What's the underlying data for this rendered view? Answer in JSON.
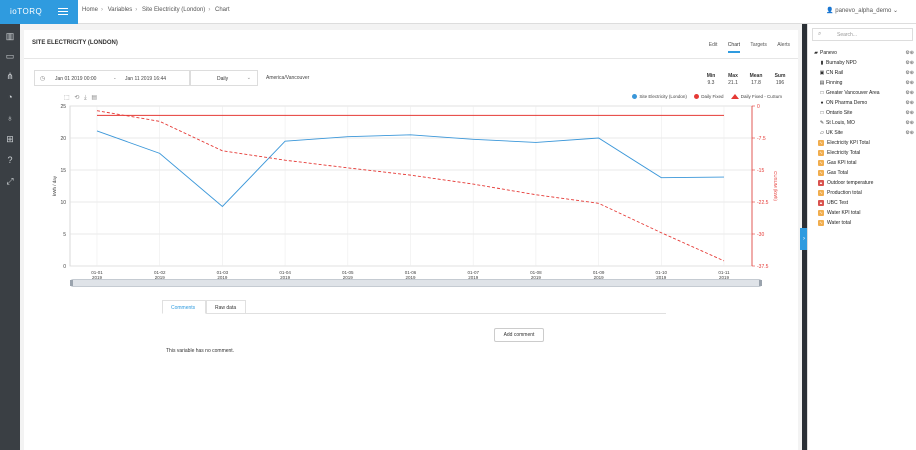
{
  "app": {
    "logo": "ioTORQ"
  },
  "breadcrumb": [
    "Home",
    "Variables",
    "Site Electricity (London)",
    "Chart"
  ],
  "user": {
    "name": "panevo_alpha_demo"
  },
  "page": {
    "title": "SITE ELECTRICITY (LONDON)",
    "tabs": [
      "Edit",
      "Chart",
      "Targets",
      "Alerts"
    ],
    "active_tab": "Chart"
  },
  "controls": {
    "date_from": "Jan 01 2019 00:00",
    "date_separator": "-",
    "date_to": "Jan 11 2019 16:44",
    "period": "Daily",
    "timezone": "America/Vancouver"
  },
  "stats": [
    {
      "label": "Min",
      "value": "9.3"
    },
    {
      "label": "Max",
      "value": "21.1"
    },
    {
      "label": "Mean",
      "value": "17.8"
    },
    {
      "label": "Sum",
      "value": "196"
    }
  ],
  "legend": [
    {
      "label": "Site Electricity (London)",
      "color": "#3b97d9",
      "shape": "dot"
    },
    {
      "label": "Daily Fixed",
      "color": "#e53935",
      "shape": "dot"
    },
    {
      "label": "Daily Fixed - CuSum",
      "color": "#e53935",
      "shape": "triangle"
    }
  ],
  "chart_data": {
    "type": "line",
    "x": [
      "01-01 2019",
      "01-02 2019",
      "01-03 2019",
      "01-04 2019",
      "01-05 2019",
      "01-06 2019",
      "01-07 2019",
      "01-08 2019",
      "01-09 2019",
      "01-10 2019",
      "01-11 2019"
    ],
    "series": [
      {
        "name": "Site Electricity (London)",
        "axis": "left",
        "style": "solid",
        "color": "#3b97d9",
        "values": [
          21.1,
          17.6,
          9.3,
          19.5,
          20.2,
          20.5,
          19.8,
          19.3,
          20.0,
          13.8,
          13.9
        ]
      },
      {
        "name": "Daily Fixed",
        "axis": "right",
        "style": "solid",
        "color": "#e53935",
        "values": [
          -2.2,
          -2.2,
          -2.2,
          -2.2,
          -2.2,
          -2.2,
          -2.2,
          -2.2,
          -2.2,
          -2.2,
          -2.2
        ]
      },
      {
        "name": "Daily Fixed - CuSum",
        "axis": "right",
        "style": "dashed",
        "color": "#e53935",
        "values": [
          -1.1,
          -3.6,
          -10.5,
          -12.7,
          -14.5,
          -16.2,
          -18.3,
          -20.8,
          -22.8,
          -29.7,
          -36.3
        ]
      }
    ],
    "ylabel_left": "kWh / day",
    "ylabel_right": "CUSUM (kWh)",
    "ylim_left": [
      0,
      25
    ],
    "yticks_left": [
      0,
      5,
      10,
      15,
      20,
      25
    ],
    "ylim_right": [
      -37.5,
      0
    ],
    "yticks_right": [
      "0",
      "-7.5",
      "-15",
      "-22.5",
      "-30",
      "-37.5"
    ],
    "grid": true
  },
  "comments": {
    "tabs": [
      "Comments",
      "Raw data"
    ],
    "add_label": "Add comment",
    "empty_text": "This variable has no comment."
  },
  "search": {
    "placeholder": "Search..."
  },
  "tree": [
    {
      "label": "Panevo",
      "icon": "folder",
      "tag": ""
    },
    {
      "label": "Burnaby NPD",
      "icon": "bar-chart",
      "tag": ""
    },
    {
      "label": "CN Rail",
      "icon": "train",
      "tag": ""
    },
    {
      "label": "Finning",
      "icon": "building",
      "tag": ""
    },
    {
      "label": "Greater Vancouver Area",
      "icon": "square",
      "tag": ""
    },
    {
      "label": "ON Pharma Demo",
      "icon": "person",
      "tag": ""
    },
    {
      "label": "Ontario Site",
      "icon": "square",
      "tag": ""
    },
    {
      "label": "St Louis, MO",
      "icon": "tool",
      "tag": ""
    },
    {
      "label": "UK Site",
      "icon": "folder-open",
      "tag": ""
    },
    {
      "label": "Electricity KPI Total",
      "icon": "",
      "tag": "y"
    },
    {
      "label": "Electricity Total",
      "icon": "",
      "tag": "y"
    },
    {
      "label": "Gas KPI total",
      "icon": "",
      "tag": "y"
    },
    {
      "label": "Gas Total",
      "icon": "",
      "tag": "y"
    },
    {
      "label": "Outdoor temperature",
      "icon": "",
      "tag": "r"
    },
    {
      "label": "Production total",
      "icon": "",
      "tag": "y"
    },
    {
      "label": "UBC Test",
      "icon": "",
      "tag": "r"
    },
    {
      "label": "Water KPI total",
      "icon": "",
      "tag": "y"
    },
    {
      "label": "Water total",
      "icon": "",
      "tag": "y"
    }
  ]
}
